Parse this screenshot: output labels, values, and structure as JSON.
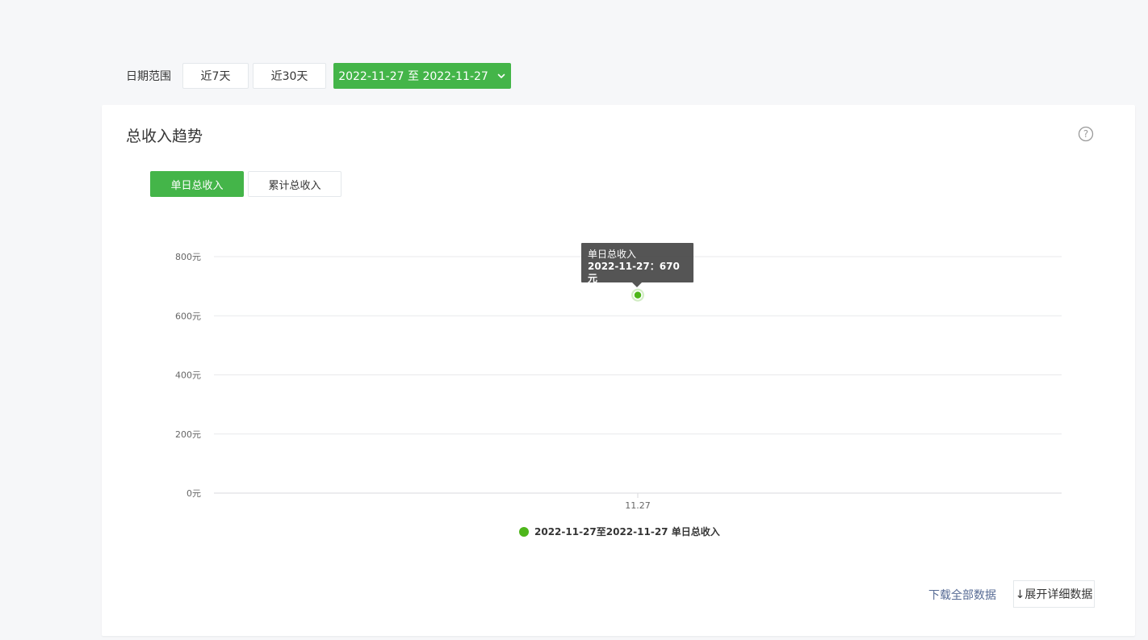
{
  "toolbar": {
    "date_range_label": "日期范围",
    "last_7_days": "近7天",
    "last_30_days": "近30天",
    "selected_range": "2022-11-27 至 2022-11-27",
    "accent_color": "#44b549"
  },
  "card": {
    "title": "总收入趋势",
    "help_icon": "question-circle-icon",
    "tabs": [
      {
        "label": "单日总收入",
        "active": true
      },
      {
        "label": "累计总收入",
        "active": false
      }
    ],
    "tooltip": {
      "series": "单日总收入",
      "value_line": "2022-11-27：670元"
    },
    "download_label": "下载全部数据",
    "expand_label": "↓展开详细数据"
  },
  "chart_data": {
    "type": "line",
    "x": [
      "11.27"
    ],
    "series": [
      {
        "name": "2022-11-27至2022-11-27 单日总收入",
        "values": [
          670
        ],
        "color": "#4eb61b"
      }
    ],
    "ylim": [
      0,
      800
    ],
    "yticks": [
      "0元",
      "200元",
      "400元",
      "600元",
      "800元"
    ],
    "ytick_values": [
      0,
      200,
      400,
      600,
      800
    ],
    "grid": true,
    "legend_position": "bottom-center"
  }
}
